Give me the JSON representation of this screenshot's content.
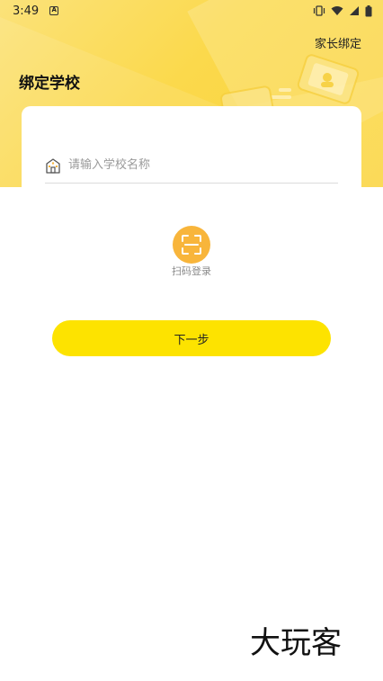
{
  "status_bar": {
    "time": "3:49",
    "notification_icon": "a-letter-icon",
    "right_icons": [
      "vibrate-icon",
      "wifi-icon",
      "signal-icon",
      "battery-icon"
    ]
  },
  "header": {
    "title": "绑定学校",
    "parent_link": "家长绑定"
  },
  "form": {
    "school_placeholder": "请输入学校名称",
    "school_value": "",
    "scan_label": "扫码登录",
    "next_label": "下一步"
  },
  "watermark": {
    "text": "大玩客"
  },
  "colors": {
    "header_yellow": "#fbd94c",
    "scan_orange": "#f8b53b",
    "button_yellow": "#fde300"
  }
}
